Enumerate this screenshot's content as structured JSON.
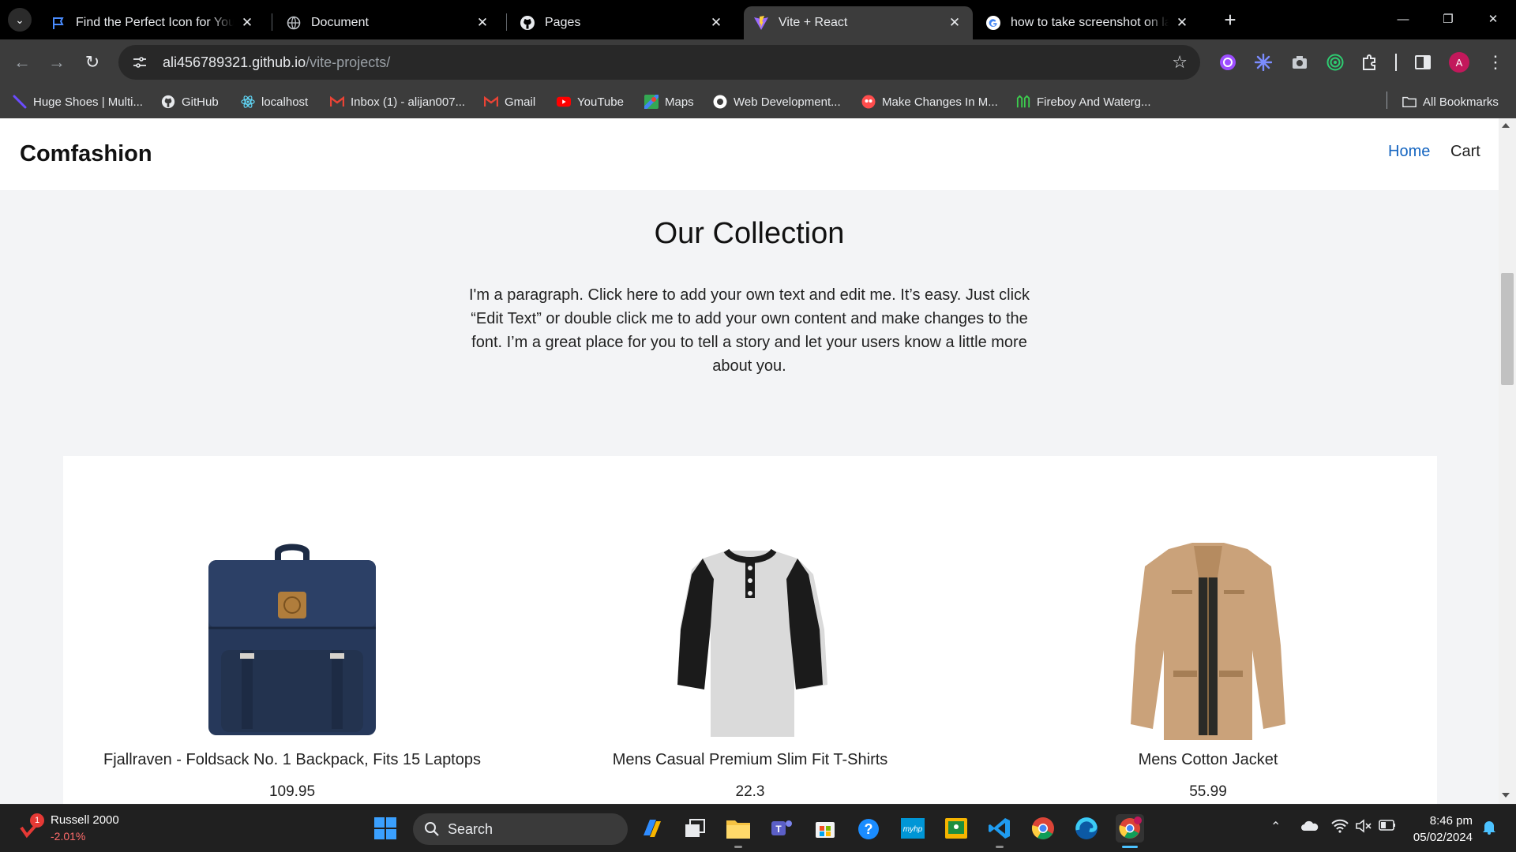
{
  "browser": {
    "tabs": [
      {
        "title": "Find the Perfect Icon for Your Pr",
        "favicon": "flag-icon"
      },
      {
        "title": "Document",
        "favicon": "globe-icon"
      },
      {
        "title": "Pages",
        "favicon": "github-icon"
      },
      {
        "title": "Vite + React",
        "favicon": "vite-icon"
      },
      {
        "title": "how to take screenshot on lapto",
        "favicon": "google-icon"
      }
    ],
    "url_host": "ali456789321.github.io",
    "url_path": "/vite-projects/",
    "bookmarks": [
      {
        "label": "Huge Shoes | Multi...",
        "icon": "feather-icon"
      },
      {
        "label": "GitHub",
        "icon": "github-icon"
      },
      {
        "label": "localhost",
        "icon": "react-icon"
      },
      {
        "label": "Inbox (1) - alijan007...",
        "icon": "gmail-icon"
      },
      {
        "label": "Gmail",
        "icon": "gmail-icon"
      },
      {
        "label": "YouTube",
        "icon": "youtube-icon"
      },
      {
        "label": "Maps",
        "icon": "maps-icon"
      },
      {
        "label": "Web Development...",
        "icon": "circle-icon"
      },
      {
        "label": "Make Changes In M...",
        "icon": "mascot-icon"
      },
      {
        "label": "Fireboy And Waterg...",
        "icon": "game-icon"
      }
    ],
    "all_bookmarks": "All Bookmarks",
    "profile_initial": "A"
  },
  "site": {
    "brand": "Comfashion",
    "nav": {
      "home": "Home",
      "cart": "Cart"
    },
    "collection_title": "Our Collection",
    "collection_text": "I'm a paragraph. Click here to add your own text and edit me. It’s easy. Just click “Edit Text” or double click me to add your own content and make changes to the font. I’m a great place for you to tell a story and let your users know a little more about you.",
    "products": [
      {
        "name": "Fjallraven - Foldsack No. 1 Backpack, Fits 15 Laptops",
        "price": "109.95",
        "image": "backpack-image"
      },
      {
        "name": "Mens Casual Premium Slim Fit T-Shirts",
        "price": "22.3",
        "image": "tshirt-image"
      },
      {
        "name": "Mens Cotton Jacket",
        "price": "55.99",
        "image": "jacket-image"
      }
    ]
  },
  "taskbar": {
    "widget_badge": "1",
    "widget_name": "Russell 2000",
    "widget_value": "-2.01%",
    "search_label": "Search",
    "time": "8:46 pm",
    "date": "05/02/2024"
  },
  "colors": {
    "link_active": "#1565c0",
    "page_bg": "#f3f4f6",
    "widget_negative": "#ff6b6b"
  }
}
